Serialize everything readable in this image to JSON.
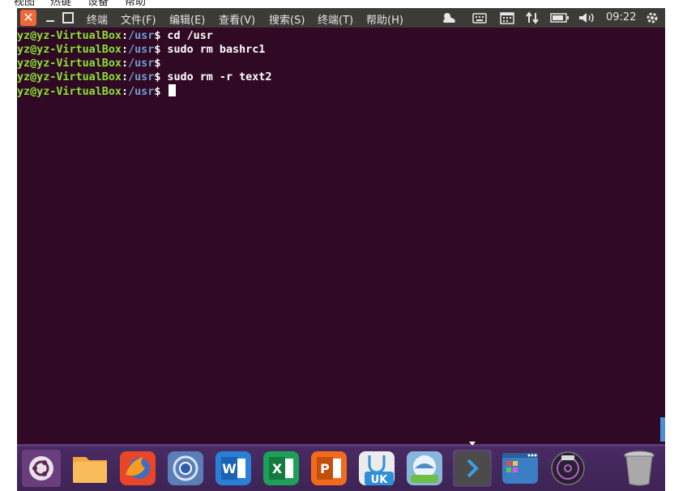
{
  "host_menu": [
    "视图",
    "热键",
    "设备",
    "帮助"
  ],
  "topbar": {
    "window_menu": [
      "终端",
      "文件(F)",
      "编辑(E)",
      "查看(V)",
      "搜索(S)",
      "终端(T)",
      "帮助(H)"
    ],
    "clock": "09:22",
    "indicators": [
      "weather-icon",
      "keyboard-icon",
      "calendar-icon",
      "network-icon",
      "battery-icon",
      "volume-icon",
      "settings-gear-icon"
    ]
  },
  "terminal": {
    "lines": [
      {
        "user": "yz@yz-VirtualBox",
        "path": "/usr",
        "cmd": " cd /usr"
      },
      {
        "user": "yz@yz-VirtualBox",
        "path": "/usr",
        "cmd": " sudo rm bashrc1"
      },
      {
        "user": "yz@yz-VirtualBox",
        "path": "/usr",
        "cmd": ""
      },
      {
        "user": "yz@yz-VirtualBox",
        "path": "/usr",
        "cmd": " sudo rm -r text2"
      },
      {
        "user": "yz@yz-VirtualBox",
        "path": "/usr",
        "cmd": ""
      }
    ]
  },
  "dock": {
    "items": [
      {
        "name": "ubuntu-launcher-icon",
        "color": "#5e2750"
      },
      {
        "name": "files-folder-icon",
        "color": "#f6a23c"
      },
      {
        "name": "firefox-icon",
        "color": "#e8562a"
      },
      {
        "name": "chromium-icon",
        "color": "#5a7fb8"
      },
      {
        "name": "wps-writer-icon",
        "color": "#2b7fd6",
        "label": "W"
      },
      {
        "name": "wps-spreadsheet-icon",
        "color": "#1da157",
        "label": "X"
      },
      {
        "name": "wps-presentation-icon",
        "color": "#f26b1d",
        "label": "P"
      },
      {
        "name": "software-center-icon",
        "color": "#e9e9e9",
        "label": "UK"
      },
      {
        "name": "ubuntu-kylin-assistant-icon",
        "color": "#6fa0c8"
      },
      {
        "name": "terminal-icon",
        "color": "#4b4b4b",
        "label": "›"
      },
      {
        "name": "workspace-switcher-icon",
        "color": "#3b7ec4"
      },
      {
        "name": "music-disc-icon",
        "color": "#2a1f33"
      },
      {
        "name": "trash-icon",
        "color": "#9a9a9a"
      }
    ]
  }
}
